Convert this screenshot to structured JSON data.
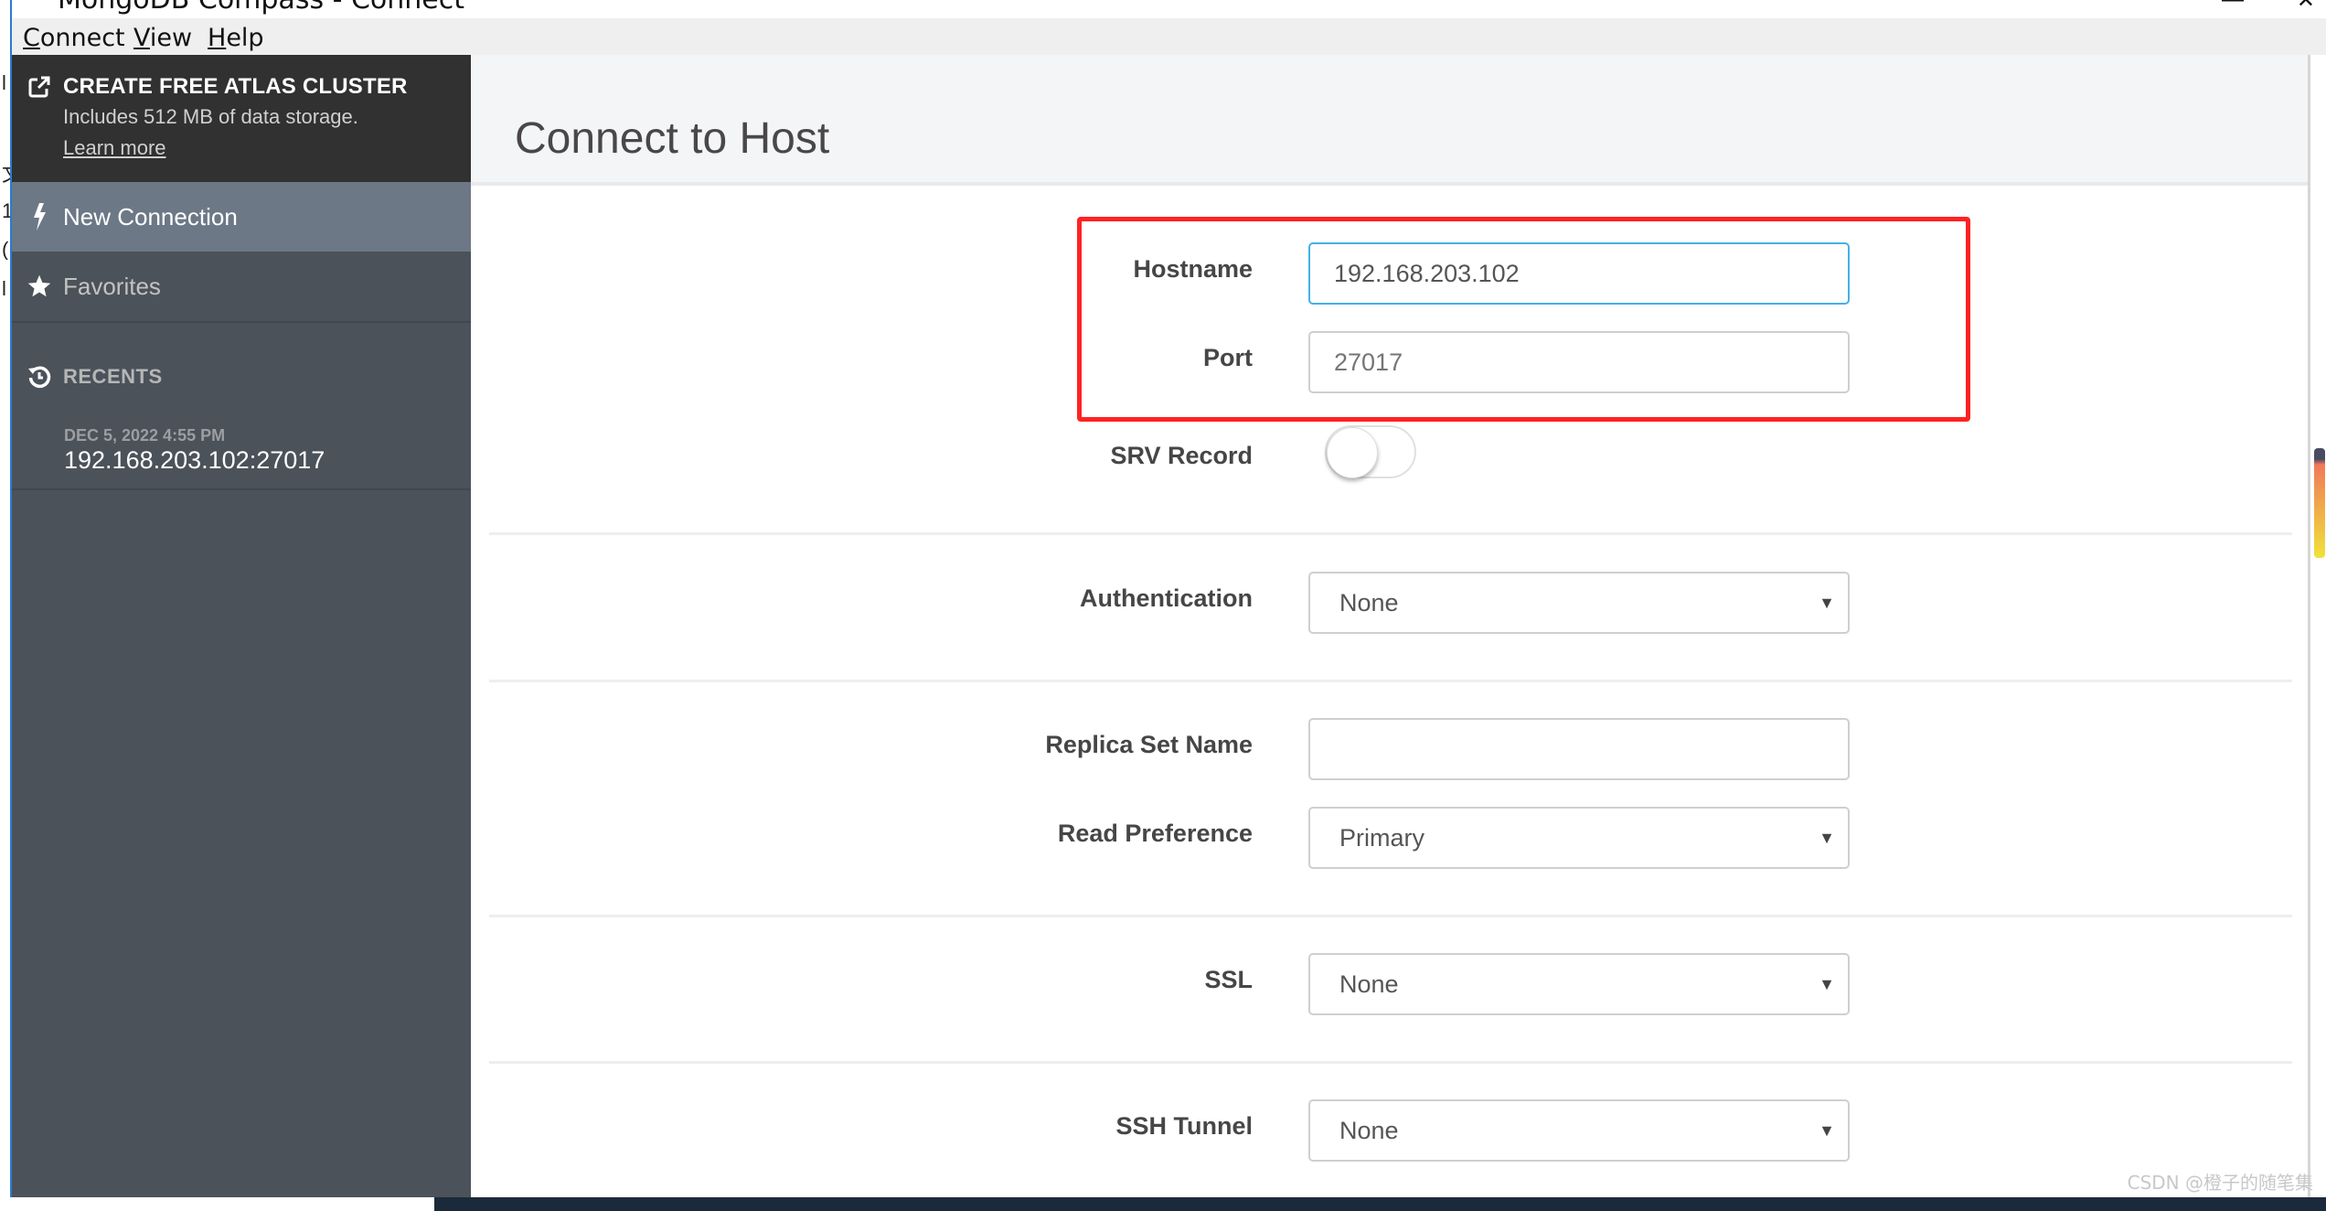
{
  "window": {
    "title": "MongoDB Compass - Connect",
    "controls": {
      "minimize": "—",
      "close": "✕"
    }
  },
  "menu": [
    {
      "key": "C",
      "rest": "onnect"
    },
    {
      "key": "V",
      "rest": "iew"
    },
    {
      "key": "H",
      "rest": "elp"
    }
  ],
  "sidebar": {
    "atlas": {
      "icon": "external-link-icon",
      "title": "CREATE FREE ATLAS CLUSTER",
      "subtitle": "Includes 512 MB of data storage.",
      "link": "Learn more"
    },
    "items": [
      {
        "label": "New Connection",
        "icon": "lightning-bolt-icon",
        "active": true
      },
      {
        "label": "Favorites",
        "icon": "star-icon",
        "active": false
      }
    ],
    "recents": {
      "label": "RECENTS",
      "icon": "history-icon",
      "items": [
        {
          "date": "DEC 5, 2022 4:55 PM",
          "host": "192.168.203.102:27017"
        }
      ]
    }
  },
  "main": {
    "title": "Connect to Host",
    "form": {
      "hostname": {
        "label": "Hostname",
        "value": "192.168.203.102"
      },
      "port": {
        "label": "Port",
        "placeholder": "27017"
      },
      "srv": {
        "label": "SRV Record",
        "enabled": false
      },
      "authentication": {
        "label": "Authentication",
        "value": "None"
      },
      "replica_set": {
        "label": "Replica Set Name",
        "value": ""
      },
      "read_preference": {
        "label": "Read Preference",
        "value": "Primary"
      },
      "ssl": {
        "label": "SSL",
        "value": "None"
      },
      "ssh_tunnel": {
        "label": "SSH Tunnel",
        "value": "None"
      }
    },
    "highlight_color": "#ff2222"
  },
  "watermark": "CSDN @橙子的随笔集",
  "colors": {
    "sidebar": "#4b525a",
    "sidebar_header": "#313131",
    "active_item": "#6c7886",
    "focus_border": "#43b1e5"
  }
}
